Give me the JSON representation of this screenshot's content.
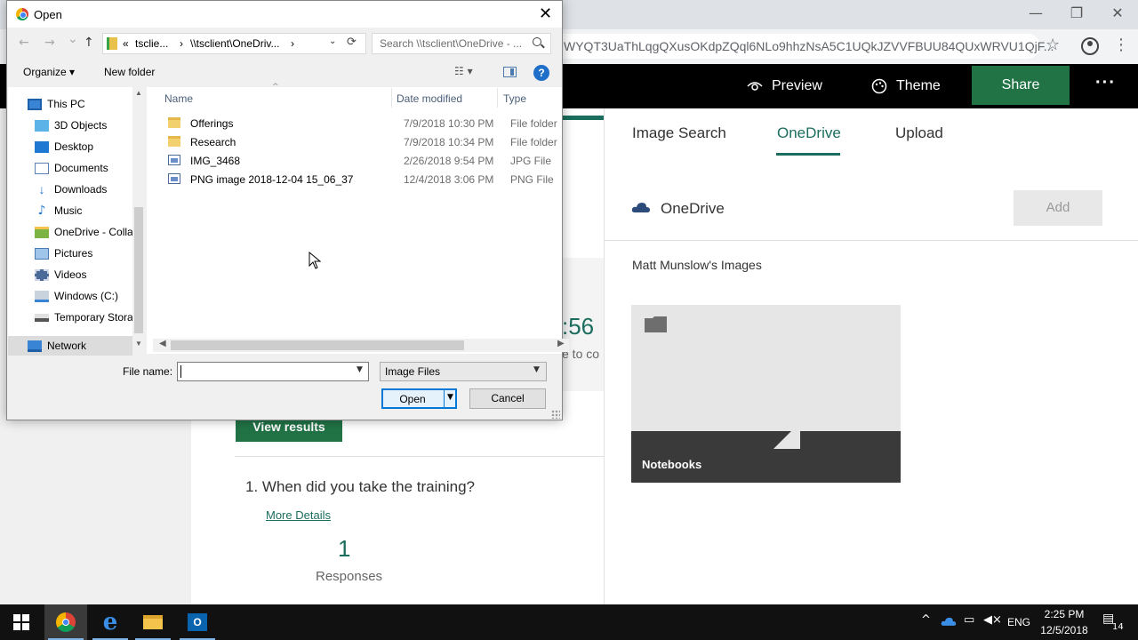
{
  "browser": {
    "url": "WYQT3UaThLqgQXusOKdpZQql6NLo9hhzNsA5C1UQkJZVVFBUU84QUxWRVU1QjF...",
    "window_controls": {
      "minimize": "—",
      "maximize": "❐",
      "close": "✕"
    },
    "star_glyph": "☆",
    "menu_glyph": "⋮"
  },
  "forms_toolbar": {
    "preview": "Preview",
    "theme": "Theme",
    "share": "Share",
    "more": "···"
  },
  "background_content": {
    "big_number": ":56",
    "sub_text": "e to co",
    "view_results": "View results",
    "question": "1.  When did you take the training?",
    "more_details": "More Details",
    "responses_count": "1",
    "responses_label": "Responses"
  },
  "picture_panel": {
    "tabs": [
      "Image Search",
      "OneDrive",
      "Upload"
    ],
    "active_tab": "OneDrive",
    "source_label": "OneDrive",
    "add_button": "Add",
    "images_heading": "Matt Munslow's Images",
    "folder_tile": "Notebooks"
  },
  "dialog": {
    "title": "Open",
    "close_glyph": "✕",
    "nav": {
      "back": "←",
      "forward": "→",
      "recent": "⌄",
      "up": "↑"
    },
    "address": {
      "segments": [
        "«",
        "tsclie...",
        "›",
        "\\\\tsclient\\OneDriv...",
        "›"
      ],
      "dropdown": "⌄",
      "refresh": "⟳"
    },
    "search_placeholder": "Search \\\\tsclient\\OneDrive - ...",
    "toolbar": {
      "organize": "Organize ▾",
      "new_folder": "New folder",
      "view_glyph": "☷ ▾",
      "help": "?"
    },
    "nav_pane": [
      {
        "label": "This PC",
        "icon": "computer-icon"
      },
      {
        "label": "3D Objects",
        "icon": "cube-icon"
      },
      {
        "label": "Desktop",
        "icon": "desktop-icon"
      },
      {
        "label": "Documents",
        "icon": "documents-icon"
      },
      {
        "label": "Downloads",
        "icon": "download-arrow-icon"
      },
      {
        "label": "Music",
        "icon": "music-note-icon"
      },
      {
        "label": "OneDrive - Colla",
        "icon": "onedrive-folder-icon"
      },
      {
        "label": "Pictures",
        "icon": "pictures-icon"
      },
      {
        "label": "Videos",
        "icon": "film-icon"
      },
      {
        "label": "Windows (C:)",
        "icon": "drive-icon"
      },
      {
        "label": "Temporary Stora",
        "icon": "removable-drive-icon"
      },
      {
        "label": "Network",
        "icon": "network-icon"
      }
    ],
    "columns": [
      "Name",
      "Date modified",
      "Type"
    ],
    "files": [
      {
        "name": "Offerings",
        "date": "7/9/2018 10:30 PM",
        "type": "File folder",
        "kind": "folder"
      },
      {
        "name": "Research",
        "date": "7/9/2018 10:34 PM",
        "type": "File folder",
        "kind": "folder"
      },
      {
        "name": "IMG_3468",
        "date": "2/26/2018 9:54 PM",
        "type": "JPG File",
        "kind": "image"
      },
      {
        "name": "PNG image 2018-12-04 15_06_37",
        "date": "12/4/2018 3:06 PM",
        "type": "PNG File",
        "kind": "image"
      }
    ],
    "file_name_label": "File name:",
    "file_name_value": "",
    "file_type_filter": "Image Files",
    "open_button": "Open",
    "cancel_button": "Cancel"
  },
  "taskbar": {
    "apps": [
      "start-icon",
      "chrome-icon",
      "edge-icon",
      "file-explorer-icon",
      "outlook-icon"
    ],
    "language": "ENG",
    "time": "2:25 PM",
    "date": "12/5/2018",
    "notification_count": "14"
  }
}
